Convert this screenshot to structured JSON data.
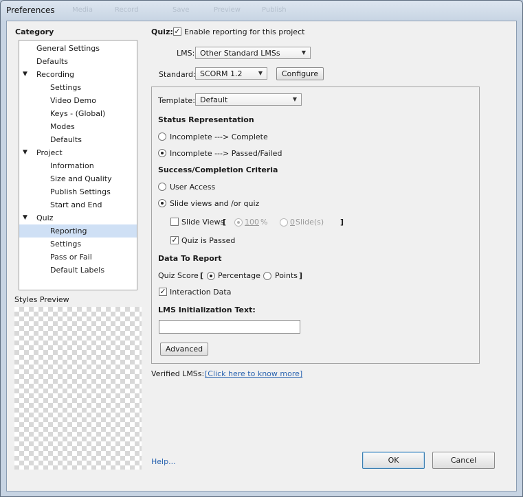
{
  "window": {
    "title": "Preferences",
    "ghost_tabs": [
      "Media",
      "Record",
      "Save",
      "Preview",
      "Publish"
    ]
  },
  "category": {
    "heading": "Category",
    "items": [
      {
        "label": "General Settings",
        "level": 0
      },
      {
        "label": "Defaults",
        "level": 0
      },
      {
        "label": "Recording",
        "level": 0,
        "expanded": true
      },
      {
        "label": "Settings",
        "level": 1
      },
      {
        "label": "Video Demo",
        "level": 1
      },
      {
        "label": "Keys - (Global)",
        "level": 1
      },
      {
        "label": "Modes",
        "level": 1
      },
      {
        "label": "Defaults",
        "level": 1
      },
      {
        "label": "Project",
        "level": 0,
        "expanded": true
      },
      {
        "label": "Information",
        "level": 1
      },
      {
        "label": "Size and Quality",
        "level": 1
      },
      {
        "label": "Publish Settings",
        "level": 1
      },
      {
        "label": "Start and End",
        "level": 1
      },
      {
        "label": "Quiz",
        "level": 0,
        "expanded": true
      },
      {
        "label": "Reporting",
        "level": 1,
        "selected": true
      },
      {
        "label": "Settings",
        "level": 1
      },
      {
        "label": "Pass or Fail",
        "level": 1
      },
      {
        "label": "Default Labels",
        "level": 1
      }
    ],
    "styles_preview_label": "Styles Preview"
  },
  "quiz": {
    "label": "Quiz:",
    "enable_reporting_label": "Enable reporting for this project",
    "enable_reporting_checked": true,
    "lms_label": "LMS:",
    "lms_value": "Other Standard LMSs",
    "standard_label": "Standard:",
    "standard_value": "SCORM 1.2",
    "configure_label": "Configure",
    "template_label": "Template:",
    "template_value": "Default",
    "status_heading": "Status Representation",
    "status_option_1": "Incomplete ---> Complete",
    "status_option_2": "Incomplete ---> Passed/Failed",
    "status_selected": 2,
    "criteria_heading": "Success/Completion Criteria",
    "criteria_option_user_access": "User Access",
    "criteria_option_slide_views": "Slide views and /or quiz",
    "slide_views_label": "Slide Views",
    "slide_views_checked": false,
    "bracket_open": "[",
    "bracket_close": "]",
    "percent_value": "100",
    "percent_unit": "%",
    "slides_value": "0",
    "slides_unit": "Slide(s)",
    "quiz_passed_label": "Quiz is Passed",
    "quiz_passed_checked": true,
    "data_heading": "Data To Report",
    "quiz_score_label": "Quiz Score",
    "percentage_label": "Percentage",
    "points_label": "Points",
    "interaction_data_label": "Interaction Data",
    "interaction_data_checked": true,
    "lms_init_heading": "LMS Initialization Text:",
    "lms_init_value": "",
    "advanced_label": "Advanced",
    "verified_label": "Verified LMSs:",
    "verified_link": "[Click here to know more]"
  },
  "footer": {
    "help_link": "Help...",
    "ok_label": "OK",
    "cancel_label": "Cancel"
  }
}
